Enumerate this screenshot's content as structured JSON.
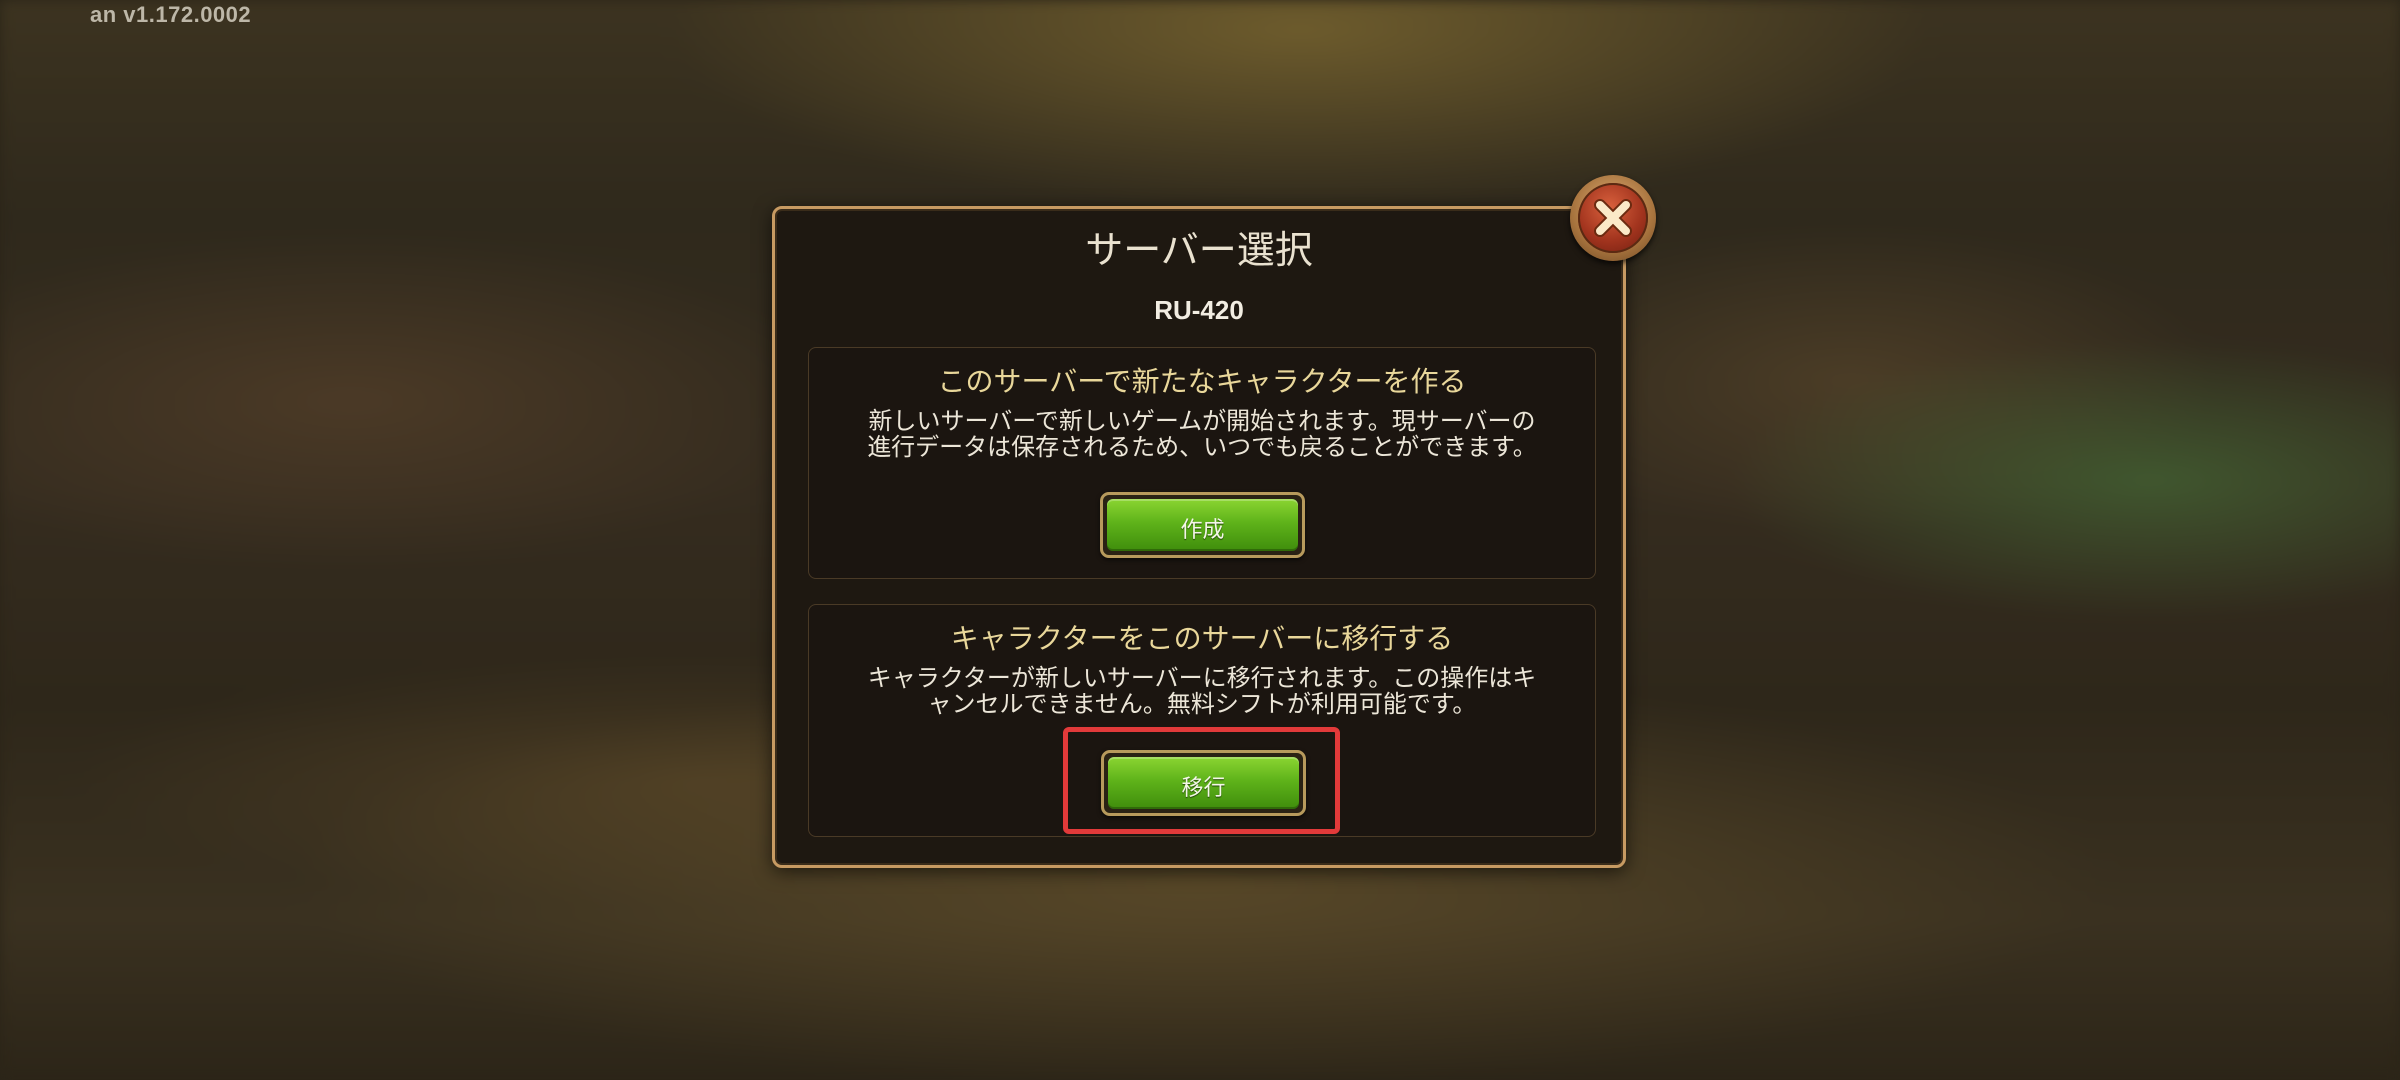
{
  "version": "an v1.172.0002",
  "modal": {
    "title": "サーバー選択",
    "server": "RU-420",
    "create_section": {
      "title": "このサーバーで新たなキャラクターを作る",
      "desc_line1": "新しいサーバーで新しいゲームが開始されます。現サーバーの",
      "desc_line2": "進行データは保存されるため、いつでも戻ることができます。",
      "button": "作成"
    },
    "transfer_section": {
      "title": "キャラクターをこのサーバーに移行する",
      "desc_line1": "キャラクターが新しいサーバーに移行されます。この操作はキ",
      "desc_line2": "ャンセルできません。無料シフトが利用可能です。",
      "button": "移行"
    }
  },
  "icons": {
    "close": "close-icon"
  },
  "colors": {
    "title_gold": "#e9d79a",
    "button_green": "#5fb31a",
    "frame_gold": "#c79a62",
    "highlight_red": "#e23a3a"
  }
}
